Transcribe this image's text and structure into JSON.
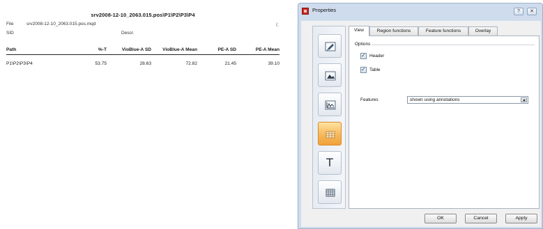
{
  "report": {
    "title": "srv2008-12-10_2063.015.pos\\P1\\P2\\P3\\P4",
    "file_label": "File",
    "file_value": "srv2008-12-10_2063.015.pos.mqd",
    "sid_label": "SID",
    "descr_label": "Descr.",
    "corner_mark": "i:",
    "columns": [
      "Path",
      "%-T",
      "VioBlue-A SD",
      "VioBlue-A Mean",
      "PE-A SD",
      "PE-A Mean"
    ],
    "rows": [
      [
        "P1\\P2\\P3\\P4",
        "53.75",
        "28.63",
        "72.82",
        "21.45",
        "39.10"
      ]
    ]
  },
  "window": {
    "title": "Properties",
    "help_icon": "question-icon",
    "close_icon": "close-icon",
    "help_glyph": "?",
    "close_glyph": "✕",
    "accent_color": "#f7b85c",
    "side_buttons": [
      {
        "icon": "edit-icon",
        "active": false
      },
      {
        "icon": "image-icon",
        "active": false
      },
      {
        "icon": "line-chart-icon",
        "active": false
      },
      {
        "icon": "table-icon",
        "active": true
      },
      {
        "icon": "text-icon",
        "active": false
      },
      {
        "icon": "grid-icon",
        "active": false
      }
    ],
    "text_glyph": "T",
    "tabs": [
      "View",
      "Region functions",
      "Feature functions",
      "Overlay"
    ],
    "active_tab": "View",
    "options_label": "Options",
    "header_checkbox": {
      "label": "Header",
      "checked": true
    },
    "table_checkbox": {
      "label": "Table",
      "checked": true
    },
    "features_label": "Features",
    "features_value": "shown using annotations",
    "buttons": {
      "ok": "OK",
      "cancel": "Cancel",
      "apply": "Apply"
    }
  }
}
